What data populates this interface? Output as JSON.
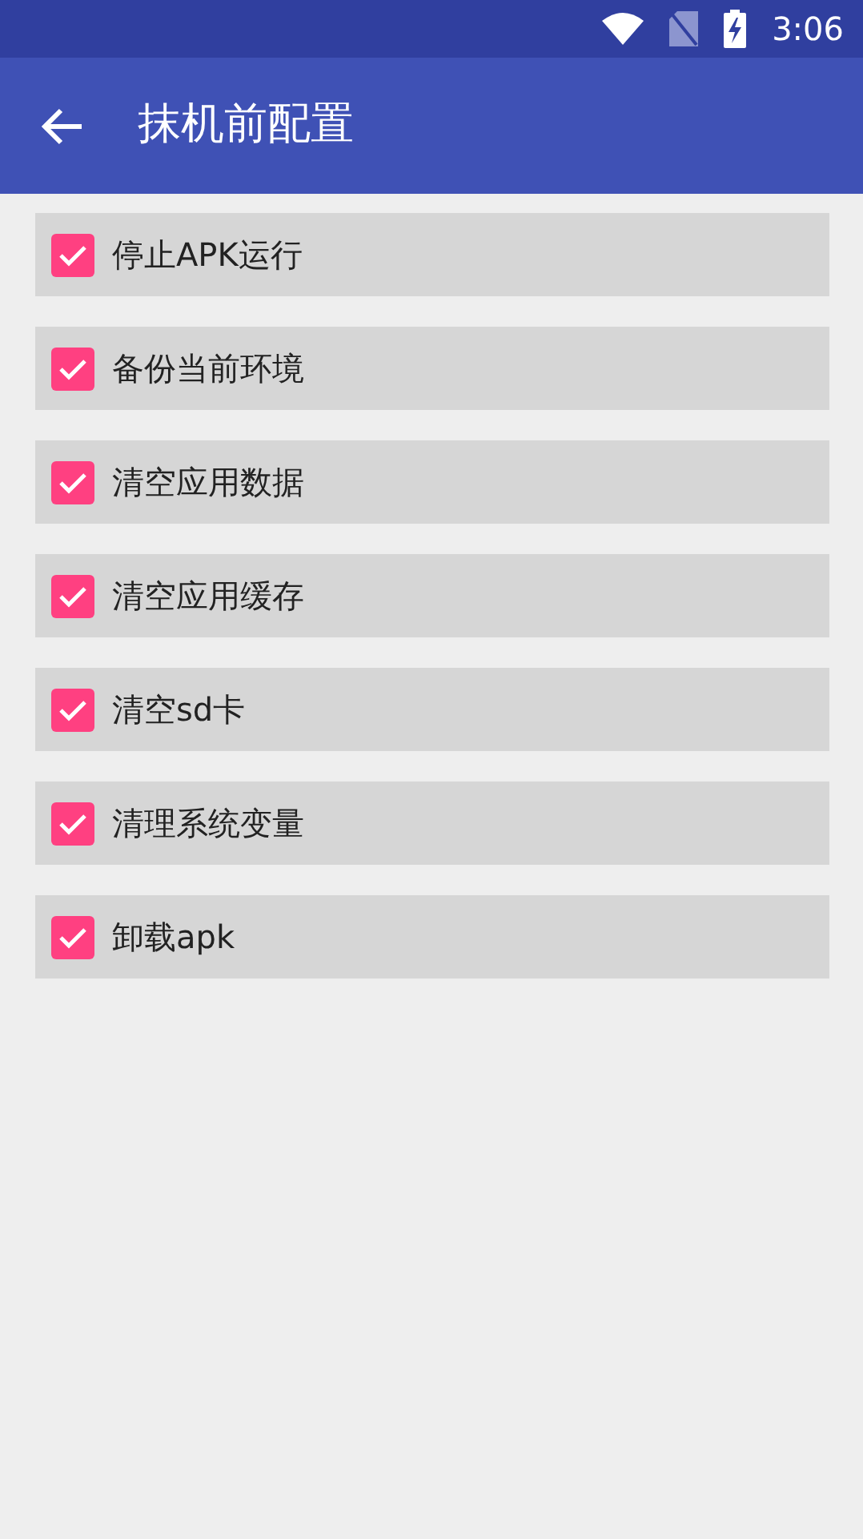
{
  "status_bar": {
    "time": "3:06"
  },
  "app_bar": {
    "title": "抹机前配置"
  },
  "options": [
    {
      "label": "停止APK运行",
      "checked": true
    },
    {
      "label": "备份当前环境",
      "checked": true
    },
    {
      "label": "清空应用数据",
      "checked": true
    },
    {
      "label": "清空应用缓存",
      "checked": true
    },
    {
      "label": "清空sd卡",
      "checked": true
    },
    {
      "label": "清理系统变量",
      "checked": true
    },
    {
      "label": "卸载apk",
      "checked": true
    }
  ]
}
